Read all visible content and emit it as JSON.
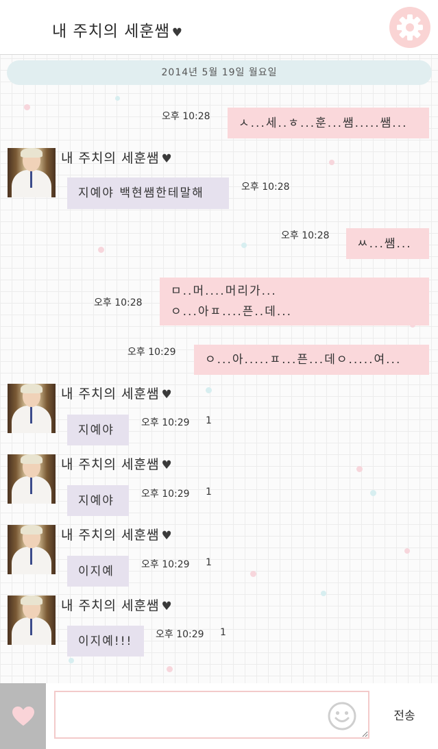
{
  "header": {
    "title": "내 주치의 세훈쌤",
    "heart": "♥",
    "settings_icon": "gear-icon"
  },
  "date_label": "2014년 5월 19일 월요일",
  "contact_name": "내 주치의 세훈쌤",
  "contact_heart": "♥",
  "messages": [
    {
      "sender": "me",
      "lines": [
        "ㅅ...세..ㅎ...훈...쌤.....쌤..."
      ],
      "time": "오후 10:28"
    },
    {
      "sender": "them",
      "lines": [
        "지예야 백현쌤한테말해"
      ],
      "time": "오후 10:28"
    },
    {
      "sender": "me",
      "lines": [
        "ㅆ...쌤..."
      ],
      "time": "오후 10:28"
    },
    {
      "sender": "me",
      "lines": [
        "ㅁ..머....머리가...",
        "ㅇ...아ㅍ....픈..데..."
      ],
      "time": "오후 10:28"
    },
    {
      "sender": "me",
      "lines": [
        "ㅇ...아.....ㅍ...픈...데ㅇ.....여..."
      ],
      "time": "오후 10:29"
    },
    {
      "sender": "them",
      "lines": [
        "지예야"
      ],
      "time": "오후 10:29",
      "unread": "1"
    },
    {
      "sender": "them",
      "lines": [
        "지예야"
      ],
      "time": "오후 10:29",
      "unread": "1"
    },
    {
      "sender": "them",
      "lines": [
        "이지예"
      ],
      "time": "오후 10:29",
      "unread": "1"
    },
    {
      "sender": "them",
      "lines": [
        "이지예!!!"
      ],
      "time": "오후 10:29",
      "unread": "1"
    }
  ],
  "composer": {
    "heart_icon": "heart-icon",
    "input_value": "",
    "emoji_icon": "smiley-icon",
    "send_label": "전송"
  },
  "colors": {
    "my_bubble": "#fad8db",
    "their_bubble": "#e6e1ee",
    "date_bar": "#e1eef0",
    "settings_button": "#fad4d4",
    "heart_button": "#b9b9b9"
  }
}
